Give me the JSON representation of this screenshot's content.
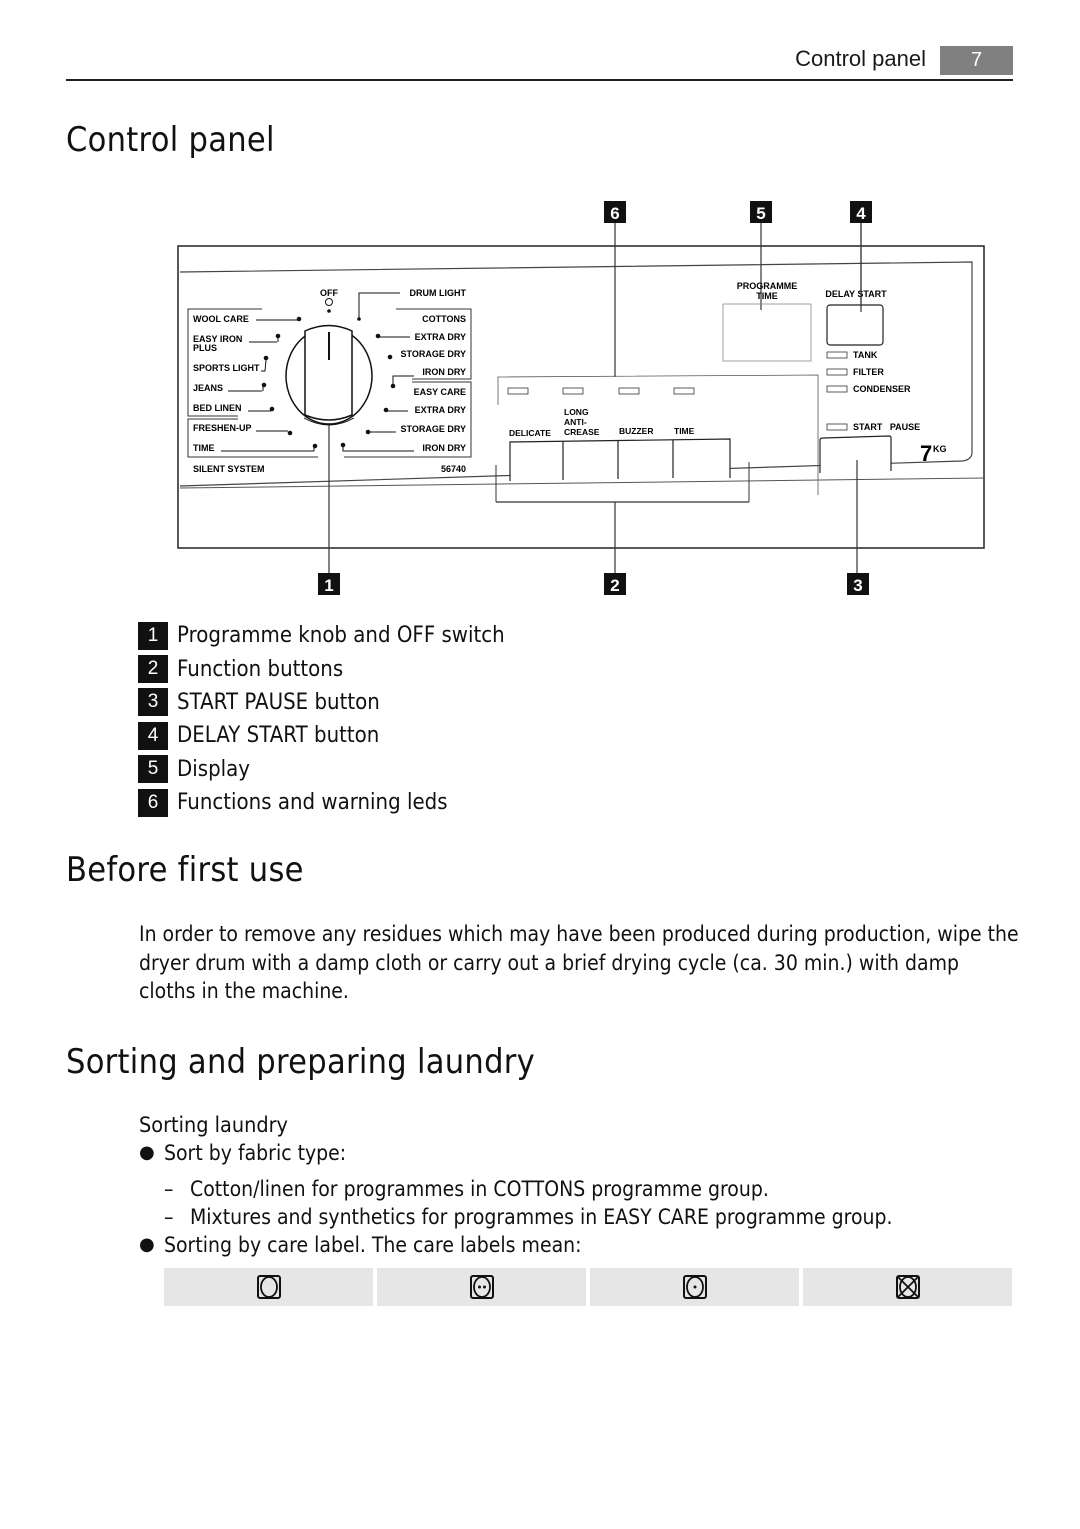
{
  "header": {
    "section_title": "Control panel",
    "page_number": "7"
  },
  "control_panel": {
    "heading": "Control panel",
    "diagram": {
      "callouts_top": [
        "6",
        "5",
        "4"
      ],
      "callouts_bottom": [
        "1",
        "2",
        "3"
      ],
      "knob": {
        "off_label": "OFF",
        "left_programmes": [
          "WOOL CARE",
          "EASY IRON",
          "PLUS",
          "SPORTS LIGHT",
          "JEANS",
          "BED LINEN",
          "FRESHEN-UP",
          "TIME"
        ],
        "right_top": "DRUM LIGHT",
        "cottons_group": [
          "COTTONS",
          "EXTRA DRY",
          "STORAGE DRY",
          "IRON DRY"
        ],
        "easy_care_group": [
          "EASY CARE",
          "EXTRA DRY",
          "STORAGE DRY",
          "IRON DRY"
        ],
        "model_label": "SILENT SYSTEM",
        "model_number": "56740"
      },
      "display": {
        "label_line1": "PROGRAMME",
        "label_line2": "TIME"
      },
      "delay_start_label": "DELAY START",
      "warning_leds": [
        "TANK",
        "FILTER",
        "CONDENSER"
      ],
      "start_pause_label": "START   PAUSE",
      "capacity": "7",
      "capacity_unit": "KG",
      "function_buttons": [
        {
          "label": "DELICATE"
        },
        {
          "label_lines": [
            "LONG",
            "ANTI-",
            "CREASE"
          ]
        },
        {
          "label": "BUZZER"
        },
        {
          "label": "TIME"
        }
      ]
    },
    "legend": [
      {
        "num": "1",
        "text": "Programme knob and OFF switch"
      },
      {
        "num": "2",
        "text": "Function buttons"
      },
      {
        "num": "3",
        "text": "START PAUSE button"
      },
      {
        "num": "4",
        "text": "DELAY START button"
      },
      {
        "num": "5",
        "text": "Display"
      },
      {
        "num": "6",
        "text": "Functions and warning leds"
      }
    ]
  },
  "before_first_use": {
    "heading": "Before first use",
    "paragraph": "In order to remove any residues which may have been produced during production, wipe the dryer drum with a damp cloth or carry out a brief drying cycle (ca. 30 min.) with damp cloths in the machine."
  },
  "sorting": {
    "heading": "Sorting and preparing laundry",
    "subheading": "Sorting laundry",
    "bullet1": "Sort by fabric type:",
    "dash_items": [
      "Cotton/linen for programmes in COTTONS programme group.",
      "Mixtures and synthetics for programmes in EASY CARE programme group."
    ],
    "bullet2": "Sorting by care label. The care labels mean:",
    "care_symbols": [
      "tumble-dry-icon",
      "tumble-dry-normal-heat-icon",
      "tumble-dry-low-heat-icon",
      "do-not-tumble-dry-icon"
    ]
  }
}
